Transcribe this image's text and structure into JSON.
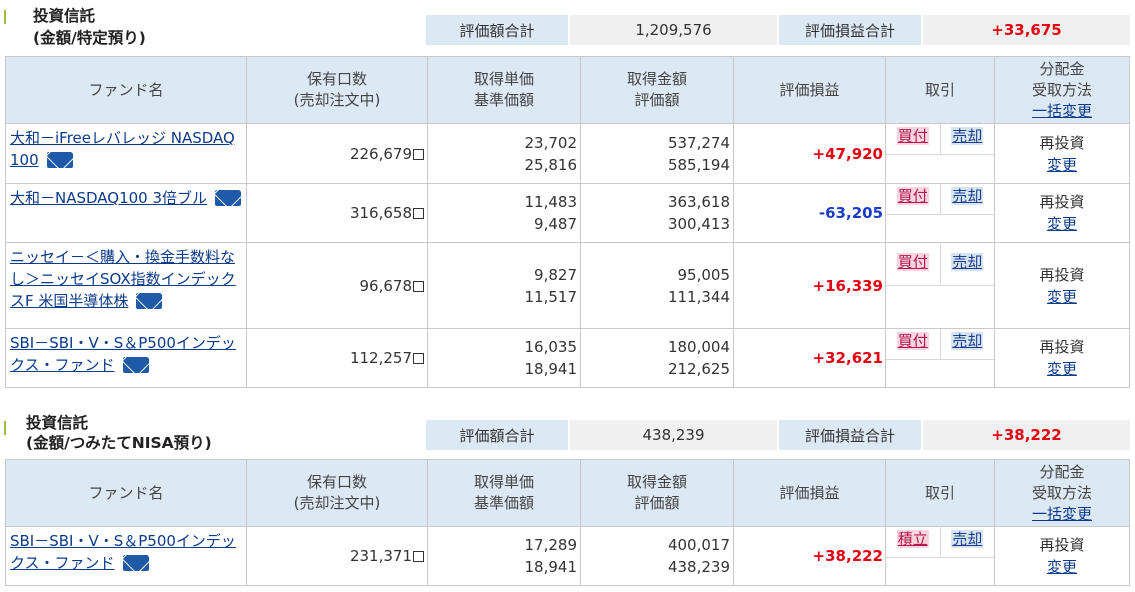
{
  "headers": {
    "fund_name": "ファンド名",
    "holding_1": "保有口数",
    "holding_2": "(売却注文中)",
    "unit_1": "取得単価",
    "unit_2": "基準価額",
    "amount_1": "取得金額",
    "amount_2": "評価額",
    "pl": "評価損益",
    "trade": "取引",
    "dist_1": "分配金",
    "dist_2": "受取方法",
    "dist_link": "一括変更"
  },
  "sections": [
    {
      "title": "投資信託",
      "subtitle": "(金額/特定預り)",
      "total_value_label": "評価額合計",
      "total_value": "1,209,576",
      "total_pl_label": "評価損益合計",
      "total_pl": "+33,675",
      "rows": [
        {
          "name": "大和－iFreeレバレッジ NASDAQ100",
          "units": "226,679",
          "acq_price": "23,702",
          "base_price": "25,816",
          "acq_amount": "537,274",
          "value": "585,194",
          "pl": "+47,920",
          "buy": "買付",
          "sell": "売却",
          "method": "再投資",
          "change": "変更"
        },
        {
          "name": "大和－NASDAQ100 3倍ブル",
          "units": "316,658",
          "acq_price": "11,483",
          "base_price": "9,487",
          "acq_amount": "363,618",
          "value": "300,413",
          "pl": "-63,205",
          "buy": "買付",
          "sell": "売却",
          "method": "再投資",
          "change": "変更"
        },
        {
          "name": "ニッセイ－＜購入・換金手数料なし＞ニッセイSOX指数インデックスF 米国半導体株",
          "units": "96,678",
          "acq_price": "9,827",
          "base_price": "11,517",
          "acq_amount": "95,005",
          "value": "111,344",
          "pl": "+16,339",
          "buy": "買付",
          "sell": "売却",
          "method": "再投資",
          "change": "変更"
        },
        {
          "name": "SBI－SBI・V・S＆P500インデックス・ファンド",
          "units": "112,257",
          "acq_price": "16,035",
          "base_price": "18,941",
          "acq_amount": "180,004",
          "value": "212,625",
          "pl": "+32,621",
          "buy": "買付",
          "sell": "売却",
          "method": "再投資",
          "change": "変更"
        }
      ]
    },
    {
      "title": "投資信託",
      "subtitle": "(金額/つみたてNISA預り)",
      "total_value_label": "評価額合計",
      "total_value": "438,239",
      "total_pl_label": "評価損益合計",
      "total_pl": "+38,222",
      "rows": [
        {
          "name": "SBI－SBI・V・S＆P500インデックス・ファンド",
          "units": "231,371",
          "acq_price": "17,289",
          "base_price": "18,941",
          "acq_amount": "400,017",
          "value": "438,239",
          "pl": "+38,222",
          "buy": "積立",
          "sell": "売却",
          "method": "再投資",
          "change": "変更"
        }
      ]
    }
  ],
  "icons": {
    "mail": "mail-icon",
    "checkbox": "checkbox-icon"
  },
  "colors": {
    "header_bg": "#dce8f3",
    "positive": "#e60012",
    "negative": "#1a3cc8",
    "link": "#0b3a8a"
  }
}
